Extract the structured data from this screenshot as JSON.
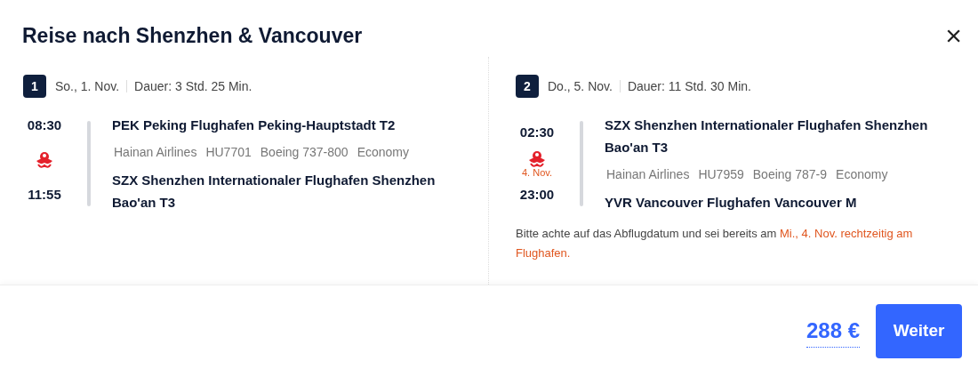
{
  "dialog": {
    "title": "Reise nach Shenzhen & Vancouver",
    "close": "×"
  },
  "legs": [
    {
      "number": "1",
      "date": "So., 1. Nov.",
      "duration": "Dauer: 3 Std. 25 Min.",
      "departure": {
        "time": "08:30",
        "airport": "PEK Peking Flughafen Peking-Hauptstadt T2"
      },
      "details": [
        "Hainan Airlines",
        "HU7701",
        "Boeing 737-800",
        "Economy"
      ],
      "arrival": {
        "time": "11:55",
        "airport": "SZX Shenzhen Internationaler Flughafen Shenzhen Bao'an T3"
      }
    },
    {
      "number": "2",
      "date": "Do., 5. Nov.",
      "duration": "Dauer: 11 Std. 30 Min.",
      "departure": {
        "time": "02:30",
        "airport": "SZX Shenzhen Internationaler Flughafen Shenzhen Bao'an T3"
      },
      "details": [
        "Hainan Airlines",
        "HU7959",
        "Boeing 787-9",
        "Economy"
      ],
      "arrival": {
        "time": "23:00",
        "airport": "YVR Vancouver Flughafen Vancouver M",
        "date_note": "4. Nov."
      },
      "notice": {
        "text": "Bitte achte auf das Abflugdatum und sei bereits am ",
        "highlight": "Mi., 4. Nov. rechtzeitig am Flughafen."
      }
    }
  ],
  "footer": {
    "price": "288 €",
    "button": "Weiter"
  }
}
